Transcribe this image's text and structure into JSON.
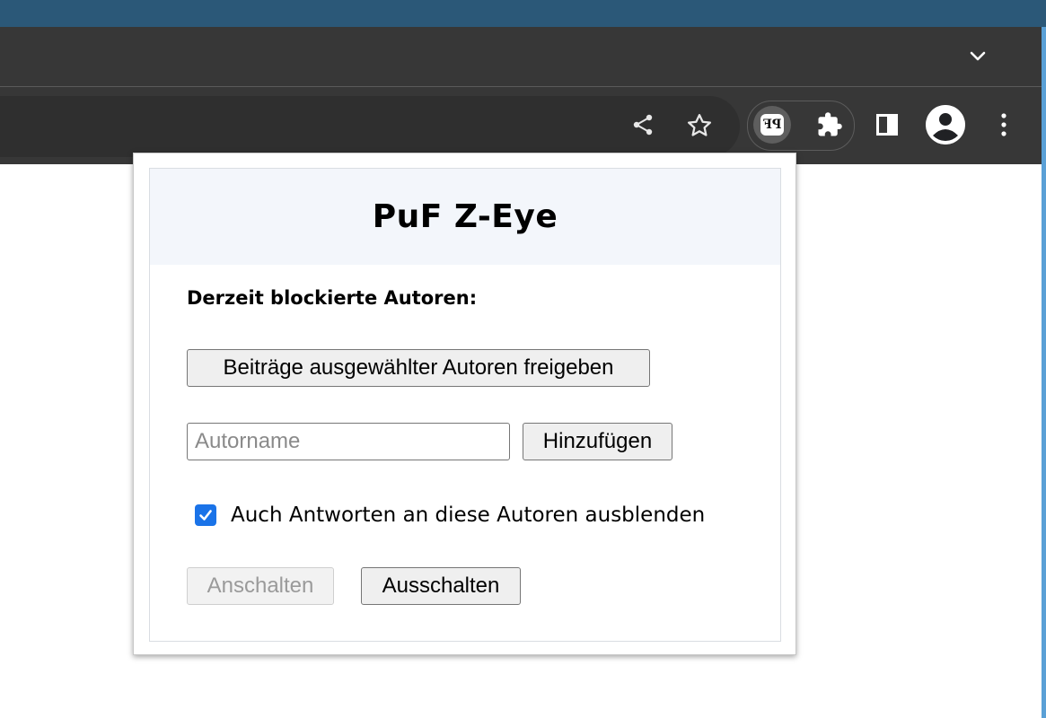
{
  "browser": {
    "tab_search": {
      "icon": "chevron-down-icon"
    },
    "toolbar": {
      "share": {
        "icon": "share-icon"
      },
      "bookmark": {
        "icon": "star-icon"
      },
      "extension_pf": {
        "icon": "pf-extension-icon",
        "badge_text": "PF"
      },
      "extensions_menu": {
        "icon": "puzzle-icon"
      },
      "side_panel": {
        "icon": "side-panel-icon"
      },
      "profile": {
        "icon": "avatar-icon"
      },
      "menu": {
        "icon": "kebab-menu-icon"
      }
    }
  },
  "popup": {
    "title": "PuF Z-Eye",
    "blocked_authors_label": "Derzeit blockierte Autoren:",
    "release_button": "Beiträge ausgewählter Autoren freigeben",
    "author_input": {
      "placeholder": "Autorname",
      "value": ""
    },
    "add_button": "Hinzufügen",
    "hide_replies": {
      "label": "Auch Antworten an diese Autoren ausblenden",
      "checked": true
    },
    "enable_button": {
      "label": "Anschalten",
      "disabled": true
    },
    "disable_button": {
      "label": "Ausschalten",
      "disabled": false
    }
  },
  "colors": {
    "desktop_top": "#2b5878",
    "browser_chrome": "#373737",
    "omnibox": "#2f2f2f",
    "header_bg": "#f3f6fb",
    "checkbox_accent": "#1a73e8"
  }
}
